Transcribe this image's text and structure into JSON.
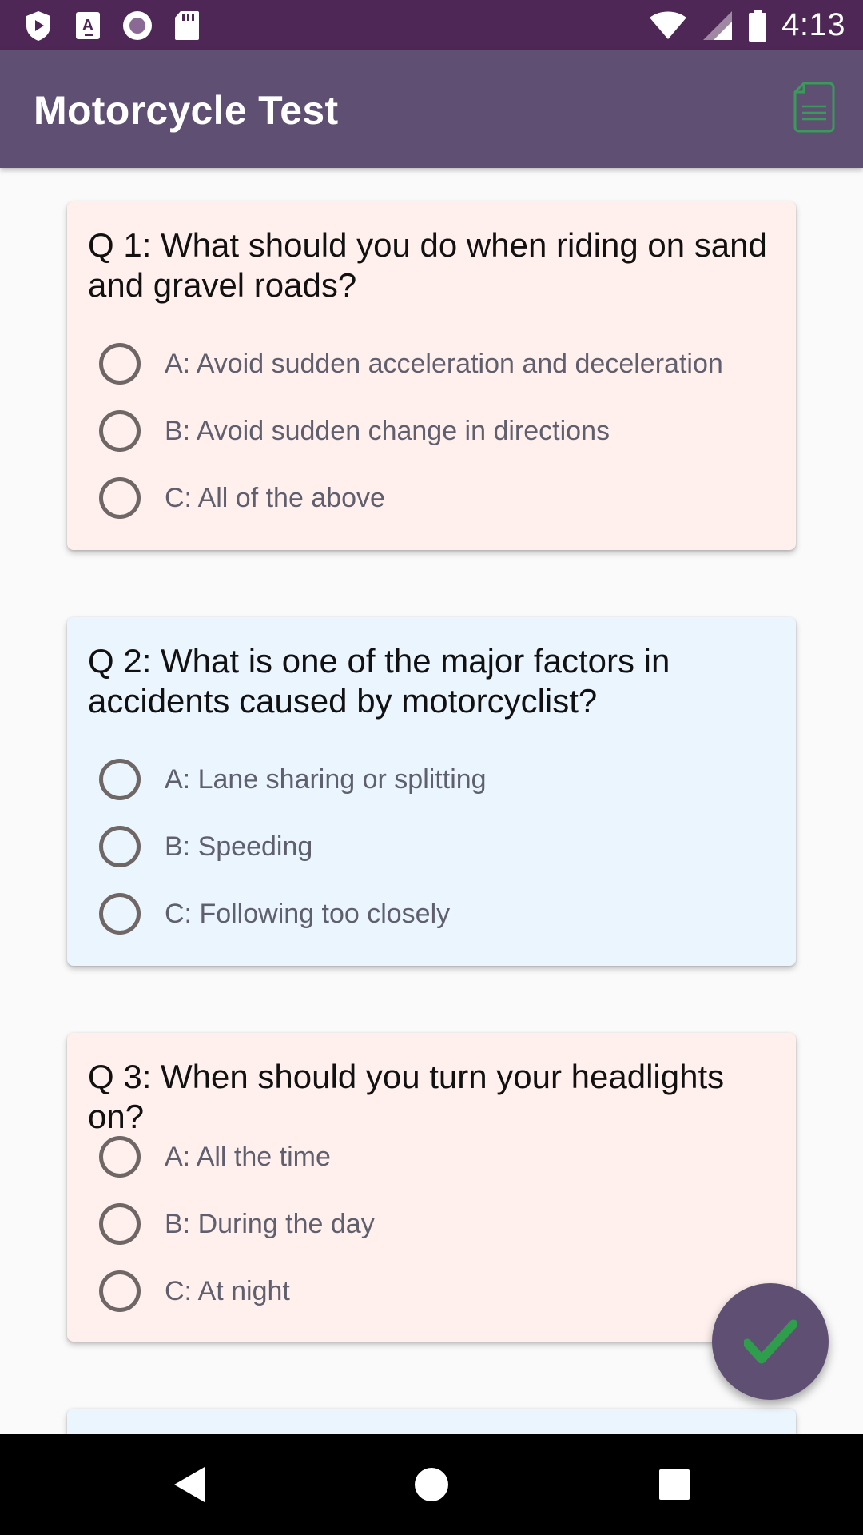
{
  "status_bar": {
    "time": "4:13",
    "icons_left": [
      "play-protect-icon",
      "a-notification-icon",
      "record-icon",
      "sd-card-icon"
    ],
    "icons_right": [
      "wifi-icon",
      "cell-signal-icon",
      "battery-icon"
    ]
  },
  "app_bar": {
    "title": "Motorcycle Test",
    "action_icon": "document-icon"
  },
  "questions": [
    {
      "text": "Q 1: What should you do when riding on sand and gravel roads?",
      "options": [
        "A: Avoid sudden acceleration and deceleration",
        "B: Avoid sudden change in directions",
        "C: All of the above"
      ]
    },
    {
      "text": "Q 2: What is one of the major factors in accidents caused by motorcyclist?",
      "options": [
        "A: Lane sharing or splitting",
        "B: Speeding",
        "C: Following too closely"
      ]
    },
    {
      "text": "Q 3: When should you turn your headlights on?",
      "options": [
        "A: All the time",
        "B: During the day",
        "C: At night"
      ]
    }
  ],
  "fab": {
    "icon": "checkmark-icon"
  },
  "nav_bar": {
    "icons": [
      "back-icon",
      "home-icon",
      "recents-icon"
    ]
  },
  "colors": {
    "status_bar": "#4f2757",
    "app_bar": "#5f5073",
    "card_pink": "#fff0ee",
    "card_blue": "#ebf5fe",
    "check": "#2e9d4c"
  }
}
